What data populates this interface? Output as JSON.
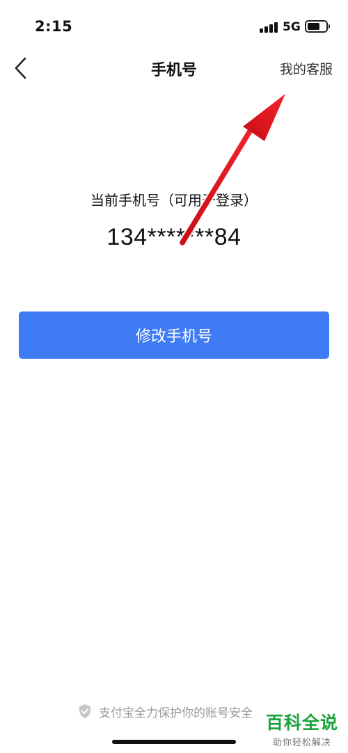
{
  "status_bar": {
    "time": "2:15",
    "network": "5G",
    "signal_icon": "signal-bars-icon",
    "battery_icon": "battery-icon"
  },
  "nav": {
    "back_icon": "chevron-left-icon",
    "title": "手机号",
    "action_label": "我的客服"
  },
  "content": {
    "phone_label": "当前手机号（可用于登录）",
    "phone_number": "134*******84",
    "change_button_label": "修改手机号"
  },
  "footer": {
    "shield_icon": "shield-icon",
    "security_note": "支付宝全力保护你的账号安全"
  },
  "watermark": {
    "main": "百科全说",
    "sub": "助你轻松解决"
  },
  "colors": {
    "primary": "#3e7bf5",
    "annotation_arrow": "#e8111b",
    "watermark_green": "#1aa33a",
    "muted_text": "#9a9a9a"
  }
}
